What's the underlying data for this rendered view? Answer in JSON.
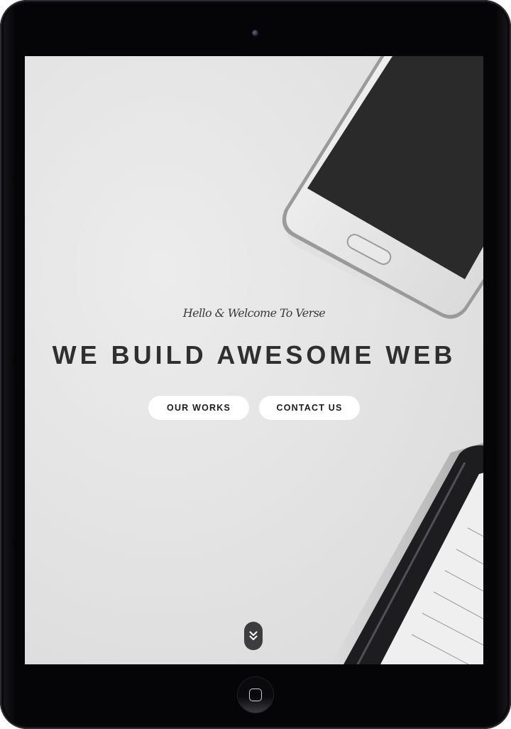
{
  "hero": {
    "tagline": "Hello & Welcome To Verse",
    "headline": "WE BUILD AWESOME WEB",
    "buttons": {
      "works_label": "OUR WORKS",
      "contact_label": "CONTACT US"
    }
  },
  "icons": {
    "scroll_down": "double-chevron-down-icon",
    "home": "home-button-icon"
  },
  "colors": {
    "tablet_bezel": "#050507",
    "screen_background": "#e4e4e4",
    "headline_text": "#2f2f2f",
    "button_background": "#ffffff",
    "scroll_indicator": "#3d3d40"
  }
}
